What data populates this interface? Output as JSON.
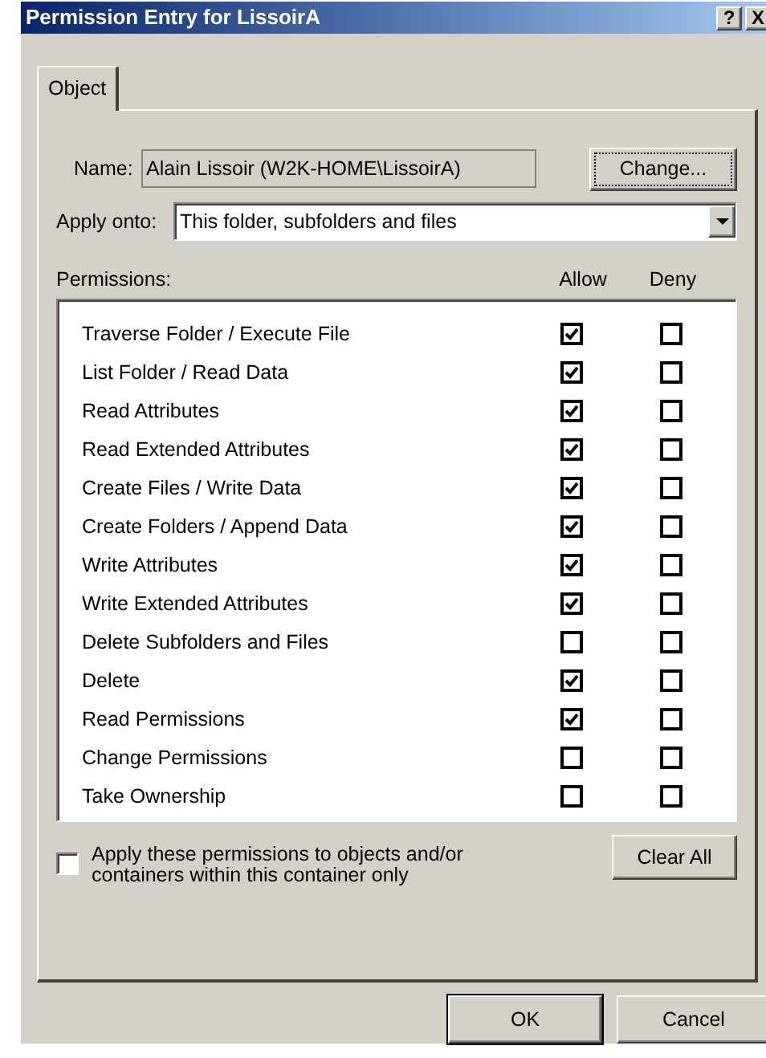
{
  "window": {
    "title": "Permission Entry for LissoirA",
    "title_buttons": [
      "?",
      "X"
    ]
  },
  "tabs": [
    {
      "label": "Object",
      "selected": true
    }
  ],
  "name": {
    "label": "Name:",
    "value": "Alain Lissoir (W2K-HOME\\LissoirA)",
    "button": "Change..."
  },
  "apply_onto": {
    "label": "Apply onto:",
    "value": "This folder, subfolders and files"
  },
  "permissions": {
    "label": "Permissions:",
    "columns": [
      "Allow",
      "Deny"
    ],
    "rows": [
      {
        "name": "Traverse Folder / Execute File",
        "allow": true,
        "deny": false
      },
      {
        "name": "List Folder / Read Data",
        "allow": true,
        "deny": false
      },
      {
        "name": "Read Attributes",
        "allow": true,
        "deny": false
      },
      {
        "name": "Read Extended Attributes",
        "allow": true,
        "deny": false
      },
      {
        "name": "Create Files / Write Data",
        "allow": true,
        "deny": false
      },
      {
        "name": "Create Folders / Append Data",
        "allow": true,
        "deny": false
      },
      {
        "name": "Write Attributes",
        "allow": true,
        "deny": false
      },
      {
        "name": "Write Extended Attributes",
        "allow": true,
        "deny": false
      },
      {
        "name": "Delete Subfolders and Files",
        "allow": false,
        "deny": false
      },
      {
        "name": "Delete",
        "allow": true,
        "deny": false
      },
      {
        "name": "Read Permissions",
        "allow": true,
        "deny": false
      },
      {
        "name": "Change Permissions",
        "allow": false,
        "deny": false
      },
      {
        "name": "Take Ownership",
        "allow": false,
        "deny": false
      }
    ]
  },
  "apply_within": {
    "label": "Apply these permissions to objects and/or containers within this container only",
    "checked": false
  },
  "clear_all": "Clear All",
  "buttons": [
    "OK",
    "Cancel"
  ]
}
